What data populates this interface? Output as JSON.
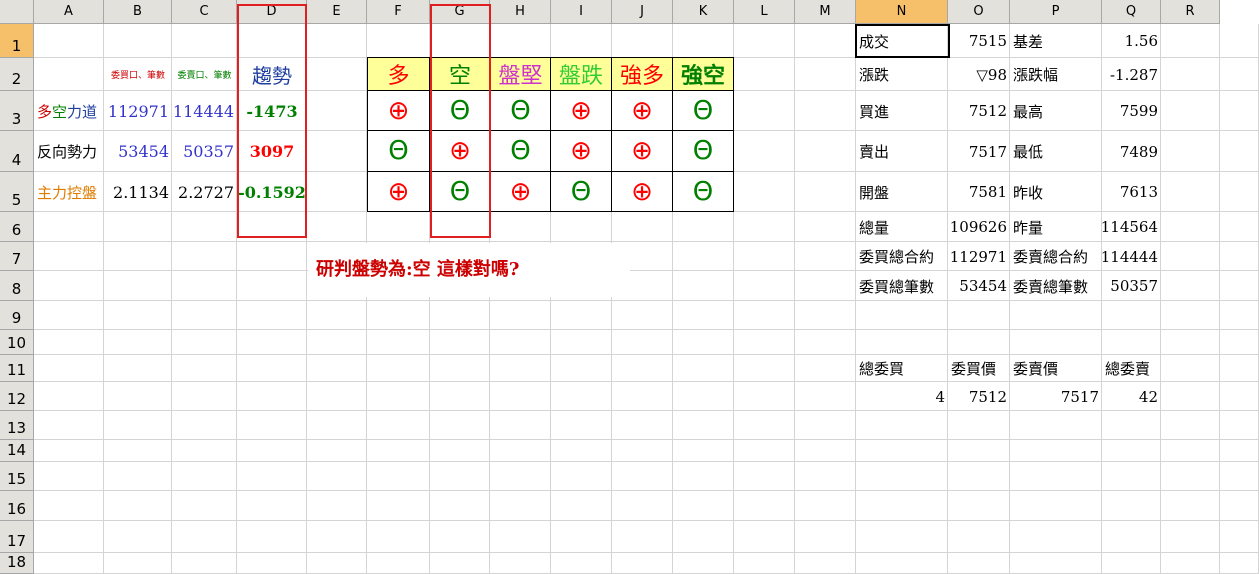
{
  "columns": [
    "A",
    "B",
    "C",
    "D",
    "E",
    "F",
    "G",
    "H",
    "I",
    "J",
    "K",
    "L",
    "M",
    "N",
    "O",
    "P",
    "Q",
    "R"
  ],
  "rows": [
    "1",
    "2",
    "3",
    "4",
    "5",
    "6",
    "7",
    "8",
    "9",
    "10",
    "11",
    "12",
    "13",
    "14",
    "15",
    "16",
    "17",
    "18"
  ],
  "headers": {
    "b2": "委買口、筆數",
    "c2": "委賣口、筆數",
    "d2": "趨勢",
    "f2": "多",
    "g2": "空",
    "h2": "盤堅",
    "i2": "盤跌",
    "j2": "強多",
    "k2": "強空"
  },
  "rows_data": [
    {
      "label": "多空力道",
      "b": "112971",
      "c": "114444",
      "d": "-1473",
      "signs": [
        "⊕",
        "Θ",
        "Θ",
        "⊕",
        "⊕",
        "Θ"
      ]
    },
    {
      "label": "反向勢力",
      "b": "53454",
      "c": "50357",
      "d": "3097",
      "signs": [
        "Θ",
        "⊕",
        "Θ",
        "⊕",
        "⊕",
        "Θ"
      ]
    },
    {
      "label": "主力控盤",
      "b": "2.1134",
      "c": "2.2727",
      "d": "-0.1592",
      "signs": [
        "⊕",
        "Θ",
        "⊕",
        "Θ",
        "⊕",
        "Θ"
      ]
    }
  ],
  "note": "研判盤勢為:空 這樣對嗎?",
  "quote": {
    "deal_label": "成交",
    "deal": "7515",
    "basis_label": "基差",
    "basis": "1.56",
    "change_label": "漲跌",
    "change": "▽98",
    "change_pct_label": "漲跌幅",
    "change_pct": "-1.287",
    "bid_label": "買進",
    "bid": "7512",
    "high_label": "最高",
    "high": "7599",
    "ask_label": "賣出",
    "ask": "7517",
    "low_label": "最低",
    "low": "7489",
    "open_label": "開盤",
    "open": "7581",
    "prev_close_label": "昨收",
    "prev_close": "7613",
    "volume_label": "總量",
    "volume": "109626",
    "prev_volume_label": "昨量",
    "prev_volume": "114564",
    "bid_total_contracts_label": "委買總合約",
    "bid_total_contracts": "112971",
    "ask_total_contracts_label": "委賣總合約",
    "ask_total_contracts": "114444",
    "bid_total_orders_label": "委買總筆數",
    "bid_total_orders": "53454",
    "ask_total_orders_label": "委賣總筆數",
    "ask_total_orders": "50357"
  },
  "depth": {
    "total_bid_label": "總委買",
    "bid_price_label": "委買價",
    "ask_price_label": "委賣價",
    "total_ask_label": "總委賣",
    "total_bid": "4",
    "bid_price": "7512",
    "ask_price": "7517",
    "total_ask": "42"
  }
}
